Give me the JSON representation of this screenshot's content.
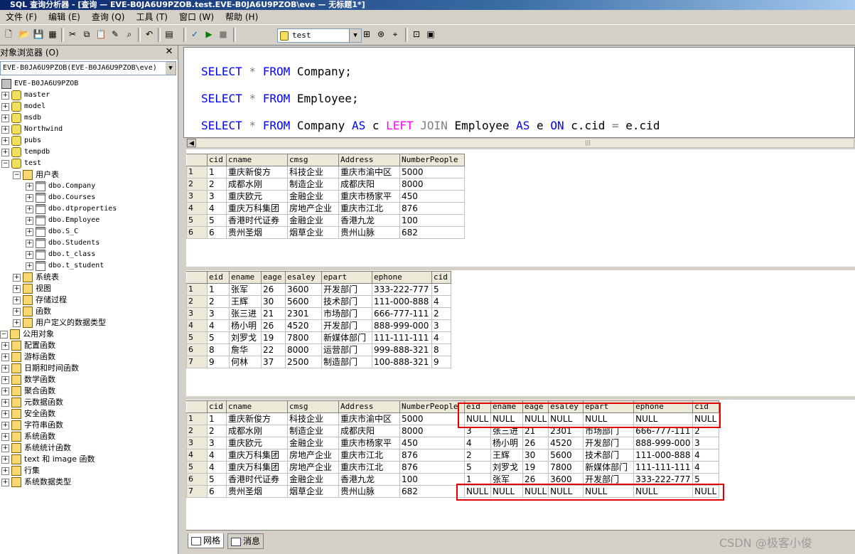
{
  "window": {
    "title": "SQL 查询分析器 - [查询 — EVE-B0JA6U9PZOB.test.EVE-B0JA6U9PZOB\\eve — 无标题1*]"
  },
  "menu": [
    "文件 (F)",
    "编辑 (E)",
    "查询 (Q)",
    "工具 (T)",
    "窗口 (W)",
    "帮助 (H)"
  ],
  "toolbar": {
    "database": "test"
  },
  "object_browser": {
    "title": "对象浏览器 (O)",
    "server_combo": "EVE-B0JA6U9PZOB(EVE-B0JA6U9PZOB\\eve)",
    "server": "EVE-B0JA6U9PZOB",
    "databases": [
      "master",
      "model",
      "msdb",
      "Northwind",
      "pubs",
      "tempdb",
      "test"
    ],
    "user_tables_folder": "用户表",
    "tables": [
      "dbo.Company",
      "dbo.Courses",
      "dbo.dtproperties",
      "dbo.Employee",
      "dbo.S_C",
      "dbo.Students",
      "dbo.t_class",
      "dbo.t_student"
    ],
    "test_folders": [
      "系统表",
      "视图",
      "存储过程",
      "函数",
      "用户定义的数据类型"
    ],
    "common_objects": "公用对象",
    "function_folders": [
      "配置函数",
      "游标函数",
      "日期和时间函数",
      "数学函数",
      "聚合函数",
      "元数据函数",
      "安全函数",
      "字符串函数",
      "系统函数",
      "系统统计函数",
      "text 和 image 函数",
      "行集",
      "系统数据类型"
    ]
  },
  "editor": {
    "line1": {
      "k1": "SELECT",
      "star": " * ",
      "k2": "FROM",
      "t": " Company;"
    },
    "line2": {
      "k1": "SELECT",
      "star": " * ",
      "k2": "FROM",
      "t": " Employee;"
    },
    "line3": {
      "k1": "SELECT",
      "star": " * ",
      "k2": "FROM",
      "t1": " Company ",
      "as1": "AS",
      "a1": " c ",
      "left": "LEFT",
      "join": " JOIN",
      "t2": " Employee ",
      "as2": "AS",
      "a2": " e ",
      "on": "ON",
      "cond1": " c.cid",
      "eq": " = ",
      "cond2": "e.cid"
    }
  },
  "result1": {
    "columns": [
      "cid",
      "cname",
      "cmsg",
      "Address",
      "NumberPeople"
    ],
    "rows": [
      [
        "1",
        "1",
        "重庆新俊方",
        "科技企业",
        "重庆市渝中区",
        "5000"
      ],
      [
        "2",
        "2",
        "成都水刚",
        "制造企业",
        "成都庆阳",
        "8000"
      ],
      [
        "3",
        "3",
        "重庆欧元",
        "金融企业",
        "重庆市杨家平",
        "450"
      ],
      [
        "4",
        "4",
        "重庆万科集团",
        "房地产企业",
        "重庆市江北",
        "876"
      ],
      [
        "5",
        "5",
        "香港时代证券",
        "金融企业",
        "香港九龙",
        "100"
      ],
      [
        "6",
        "6",
        "贵州圣烟",
        "烟草企业",
        "贵州山脉",
        "682"
      ]
    ]
  },
  "result2": {
    "columns": [
      "eid",
      "ename",
      "eage",
      "esaley",
      "epart",
      "ephone",
      "cid"
    ],
    "rows": [
      [
        "1",
        "1",
        "张军",
        "26",
        "3600",
        "开发部门",
        "333-222-777",
        "5"
      ],
      [
        "2",
        "2",
        "王辉",
        "30",
        "5600",
        "技术部门",
        "111-000-888",
        "4"
      ],
      [
        "3",
        "3",
        "张三进",
        "21",
        "2301",
        "市场部门",
        "666-777-111",
        "2"
      ],
      [
        "4",
        "4",
        "杨小明",
        "26",
        "4520",
        "开发部门",
        "888-999-000",
        "3"
      ],
      [
        "5",
        "5",
        "刘罗戈",
        "19",
        "7800",
        "新媒体部门",
        "111-111-111",
        "4"
      ],
      [
        "6",
        "8",
        "詹华",
        "22",
        "8000",
        "运营部门",
        "999-888-321",
        "8"
      ],
      [
        "7",
        "9",
        "何林",
        "37",
        "2500",
        "制造部门",
        "100-888-321",
        "9"
      ]
    ]
  },
  "result3": {
    "columns": [
      "cid",
      "cname",
      "cmsg",
      "Address",
      "NumberPeople",
      "eid",
      "ename",
      "eage",
      "esaley",
      "epart",
      "ephone",
      "cid"
    ],
    "rows": [
      [
        "1",
        "1",
        "重庆新俊方",
        "科技企业",
        "重庆市渝中区",
        "5000",
        "NULL",
        "NULL",
        "NULL",
        "NULL",
        "NULL",
        "NULL",
        "NULL"
      ],
      [
        "2",
        "2",
        "成都水刚",
        "制造企业",
        "成都庆阳",
        "8000",
        "3",
        "张三进",
        "21",
        "2301",
        "市场部门",
        "666-777-111",
        "2"
      ],
      [
        "3",
        "3",
        "重庆欧元",
        "金融企业",
        "重庆市杨家平",
        "450",
        "4",
        "杨小明",
        "26",
        "4520",
        "开发部门",
        "888-999-000",
        "3"
      ],
      [
        "4",
        "4",
        "重庆万科集团",
        "房地产企业",
        "重庆市江北",
        "876",
        "2",
        "王辉",
        "30",
        "5600",
        "技术部门",
        "111-000-888",
        "4"
      ],
      [
        "5",
        "4",
        "重庆万科集团",
        "房地产企业",
        "重庆市江北",
        "876",
        "5",
        "刘罗戈",
        "19",
        "7800",
        "新媒体部门",
        "111-111-111",
        "4"
      ],
      [
        "6",
        "5",
        "香港时代证券",
        "金融企业",
        "香港九龙",
        "100",
        "1",
        "张军",
        "26",
        "3600",
        "开发部门",
        "333-222-777",
        "5"
      ],
      [
        "7",
        "6",
        "贵州圣烟",
        "烟草企业",
        "贵州山脉",
        "682",
        "NULL",
        "NULL",
        "NULL",
        "NULL",
        "NULL",
        "NULL",
        "NULL"
      ]
    ]
  },
  "tabs": {
    "grid": "网格",
    "messages": "消息"
  },
  "watermark": "CSDN @极客小俊",
  "colors": {
    "keyword": "#0000ff",
    "join_keyword": "#ff00ff",
    "highlight_box": "#e00000"
  }
}
